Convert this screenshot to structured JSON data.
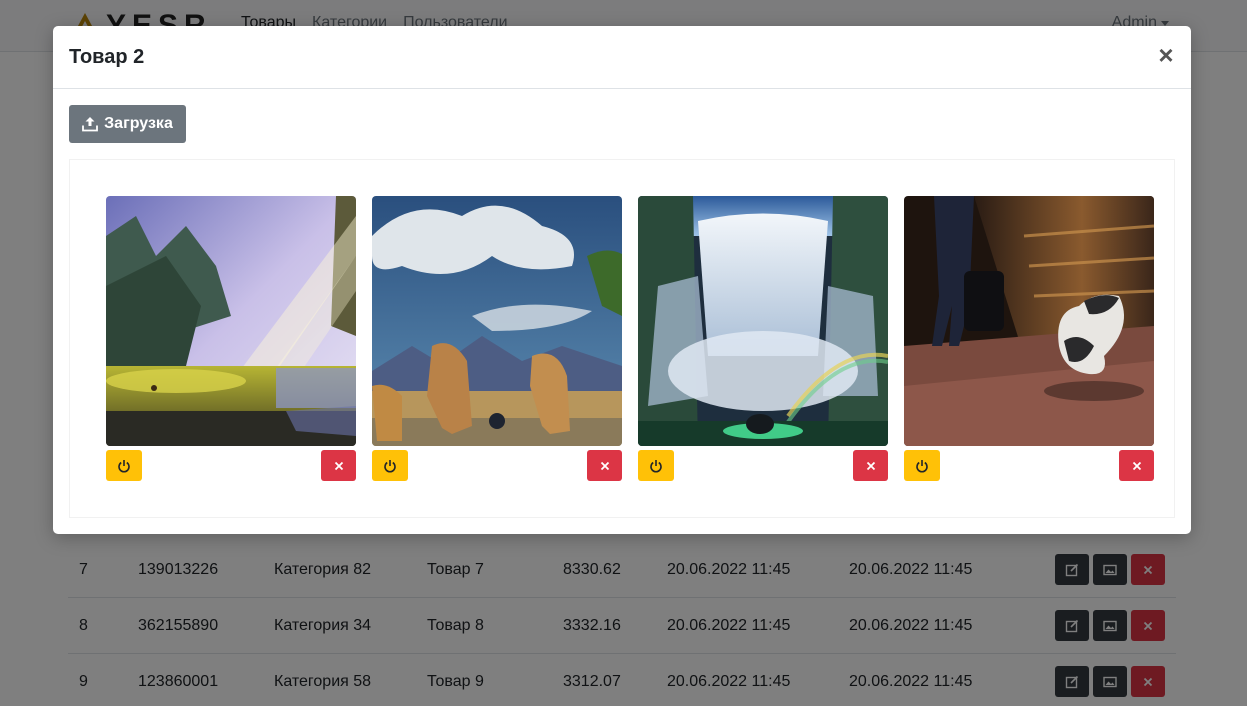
{
  "navbar": {
    "brand": "YESR",
    "links": [
      "Товары",
      "Категории",
      "Пользователи"
    ],
    "user": "Admin"
  },
  "table": {
    "rows": [
      {
        "id": "7",
        "code": "139013226",
        "category": "Категория 82",
        "name": "Товар 7",
        "price": "8330.62",
        "created": "20.06.2022 11:45",
        "updated": "20.06.2022 11:45"
      },
      {
        "id": "8",
        "code": "362155890",
        "category": "Категория 34",
        "name": "Товар 8",
        "price": "3332.16",
        "created": "20.06.2022 11:45",
        "updated": "20.06.2022 11:45"
      },
      {
        "id": "9",
        "code": "123860001",
        "category": "Категория 58",
        "name": "Товар 9",
        "price": "3312.07",
        "created": "20.06.2022 11:45",
        "updated": "20.06.2022 11:45"
      }
    ],
    "row_action_icons": [
      "edit-icon",
      "image-icon",
      "close-icon"
    ]
  },
  "modal": {
    "title": "Товар 2",
    "close_label": "×",
    "upload_label": "Загрузка",
    "upload_icon": "upload-icon",
    "images": [
      {
        "subject": "forest-clearing",
        "power_icon": "power-icon",
        "delete_icon": "close-icon"
      },
      {
        "subject": "lions-at-water",
        "power_icon": "power-icon",
        "delete_icon": "close-icon"
      },
      {
        "subject": "waterfall-rainbow",
        "power_icon": "power-icon",
        "delete_icon": "close-icon"
      },
      {
        "subject": "cat-at-train",
        "power_icon": "power-icon",
        "delete_icon": "close-icon"
      }
    ]
  },
  "colors": {
    "warning": "#ffc107",
    "danger": "#dc3545",
    "secondary": "#6c757d",
    "dark": "#343a40"
  }
}
